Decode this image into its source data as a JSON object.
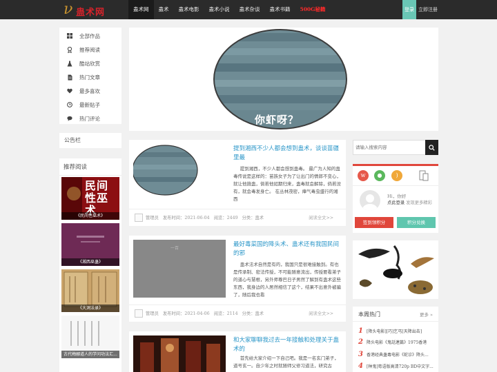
{
  "header": {
    "logo_text": "蛊术网",
    "nav": [
      {
        "label": "蛊术网",
        "active": true
      },
      {
        "label": "蛊术"
      },
      {
        "label": "蛊术电影"
      },
      {
        "label": "蛊术小说"
      },
      {
        "label": "蛊术杂谈"
      },
      {
        "label": "蛊术书籍"
      },
      {
        "label": "500G秘籍",
        "hot": true
      }
    ],
    "login": "登录",
    "register": "立即注册"
  },
  "sidebar": {
    "menu": [
      {
        "label": "全部作品",
        "icon": "grid-icon"
      },
      {
        "label": "推荐阅读",
        "icon": "award-icon"
      },
      {
        "label": "酷站欣赏",
        "icon": "flask-icon"
      },
      {
        "label": "热门文章",
        "icon": "document-icon"
      },
      {
        "label": "最多喜欢",
        "icon": "heart-icon"
      },
      {
        "label": "最新贴子",
        "icon": "clock-icon"
      },
      {
        "label": "热门评论",
        "icon": "comment-icon"
      }
    ],
    "notice_title": "公告栏",
    "rec_title": "推荐阅读",
    "rec_items": [
      {
        "caption": "《民间性巫术》",
        "cover_text": "民间性巫术"
      },
      {
        "caption": "《湘西巫蛊》"
      },
      {
        "caption": "《大洞法录》"
      },
      {
        "caption": "古代梅郦道人的学问功法汇..."
      }
    ]
  },
  "banner": {
    "caption": "你虾呀？"
  },
  "articles": [
    {
      "title": "提到湘西不少人都会想到蛊术，谈谈苗疆里最",
      "body": "提到湘西，不少人都会想到蛊毒。 最广为人知的蛊毒传说是这样的：苗族女子为了让出门的情郎不变心，就让他施蛊，倘若他如期归来，蛊毒就会解除，倘若没有，就会毒发身亡。 在丛林茂密，瘴气毒虫盛行的湘西",
      "author": "管理员",
      "date": "发布时间：2021-06-04",
      "views": "阅览：2449",
      "category": "分类：蛊术",
      "more": "阅读全文>>"
    },
    {
      "title": "最好毒菜国的降头术、蛊术还有我国民间的邪",
      "body": "蛊术法术自然是有的，我国只是很难接触到。有也是传承制、密法传授，不可能随意流出，传授要看弟子的道心与慧根，另外师尊巴日子男然了解到有蛊术这些东西，我身边的人居然相信了这个，结果不出意外被骗了，随后我也看",
      "author": "管理员",
      "date": "发布时间：2021-04-06",
      "views": "阅览：2114",
      "category": "分类：蛊术",
      "more": "阅读全文>>"
    },
    {
      "title": "和大家聊聊我过去一年接触和处理关于蛊术的",
      "body": "首先给大家介绍一下自己吧。我是一名玄门弟子，道号玄一。自少年之时就随师父修习道法，研究古"
    }
  ],
  "right": {
    "search_placeholder": "请输入搜索内容",
    "hello": "Hi，你好",
    "login_tip": "点此登录",
    "login_tip2": "发现更多精彩",
    "sign_btn": "签到领积分",
    "exchange_btn": "积分兑换",
    "hot_title": "本周热门",
    "hot_more": "更多 »",
    "hot_items": [
      {
        "num": "1",
        "title": "[降头电影][巧]乞丐[天降出击]"
      },
      {
        "num": "2",
        "title": "降头电影《鬼話連篇》1975香港"
      },
      {
        "num": "3",
        "title": "香港经典蛊毒电影《蛇诊》降头..."
      },
      {
        "num": "4",
        "title": "[种鬼]粤语版高清720p BD中文字..."
      }
    ]
  },
  "colors": {
    "accent": "#2a96c8",
    "red": "#e0463b",
    "teal": "#69c7b5"
  }
}
